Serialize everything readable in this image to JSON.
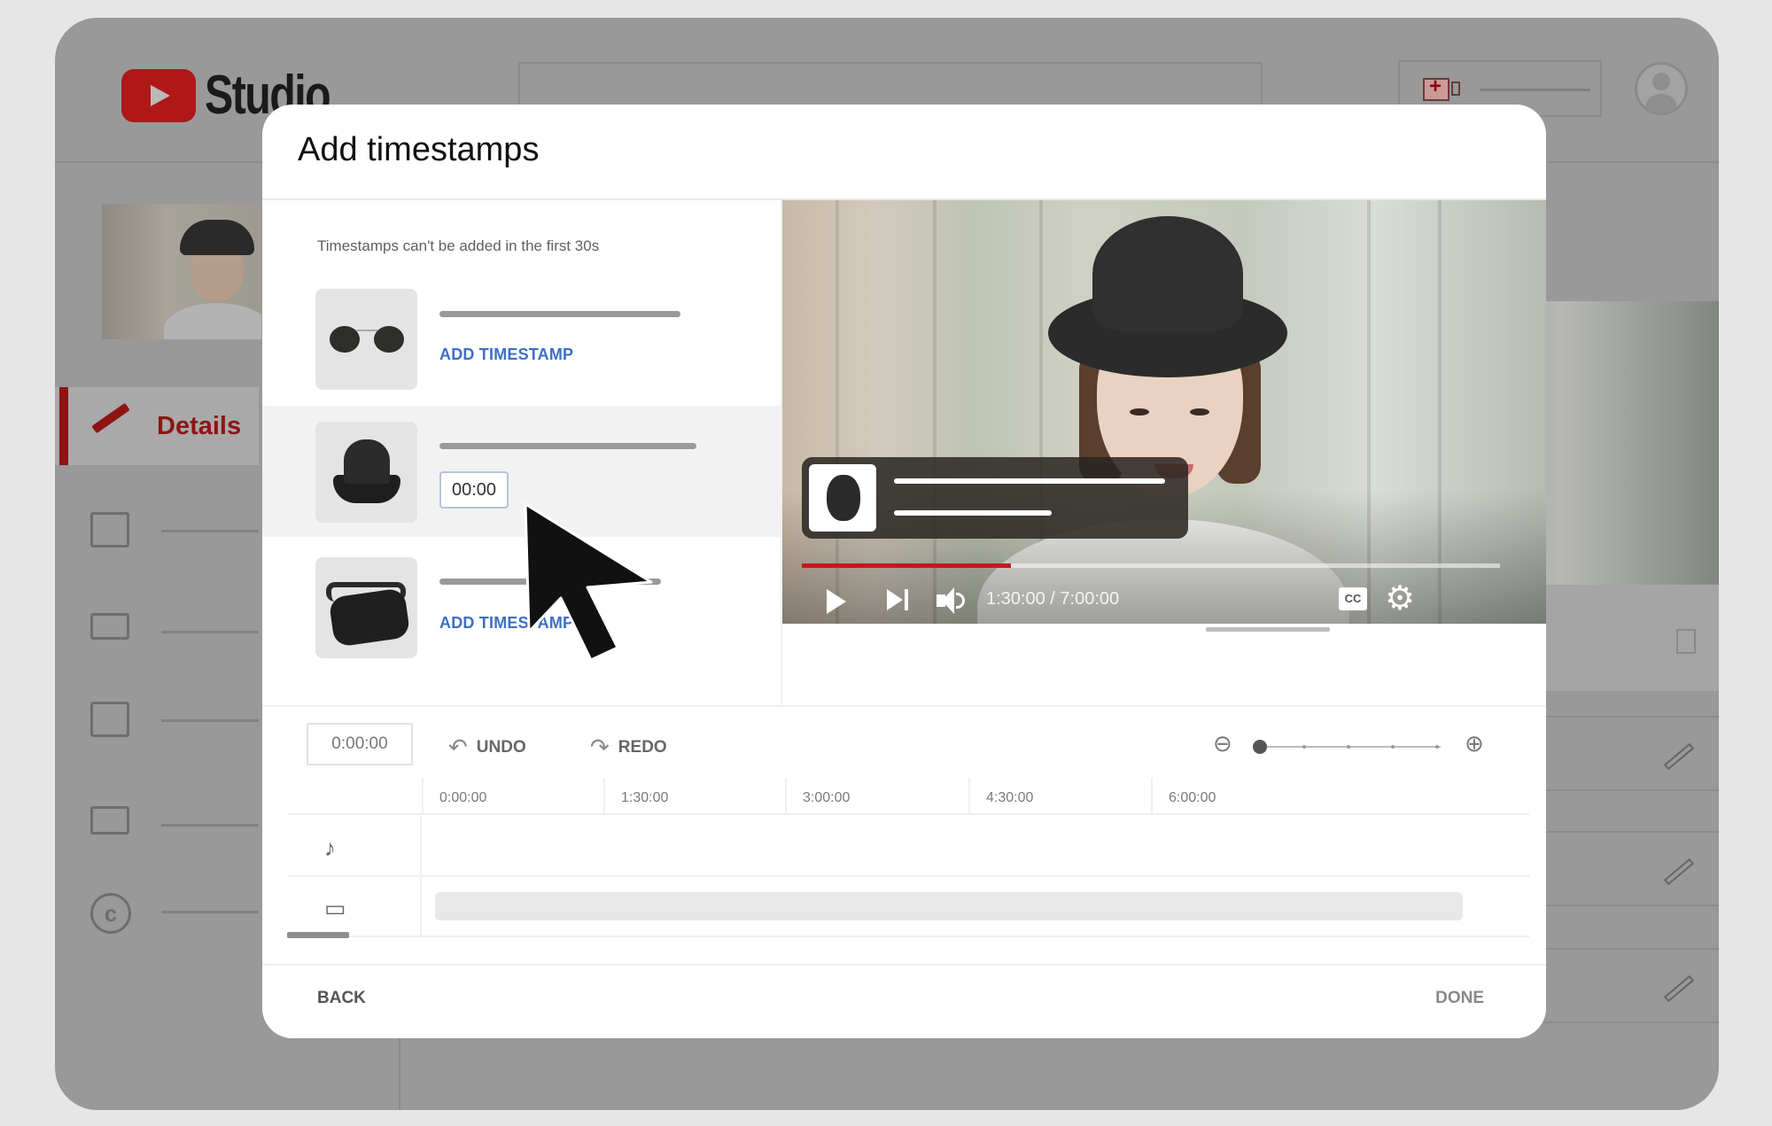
{
  "app": {
    "logo_text": "Studio",
    "sidebar": {
      "active_item": "Details",
      "items": [
        {
          "icon": "analytics-icon"
        },
        {
          "icon": "editor-icon"
        },
        {
          "icon": "comments-icon"
        },
        {
          "icon": "subtitles-icon"
        },
        {
          "icon": "copyright-icon"
        }
      ]
    }
  },
  "dialog": {
    "title": "Add timestamps",
    "note": "Timestamps can't be added in the first 30s",
    "products": [
      {
        "name": "sunglasses",
        "action_label": "ADD TIMESTAMP",
        "selected": false
      },
      {
        "name": "bucket-hat",
        "timestamp_value": "00:00",
        "selected": true
      },
      {
        "name": "belt-bag",
        "action_label": "ADD TIMESTAMP",
        "selected": false
      }
    ],
    "player": {
      "current_time": "1:30:00",
      "duration": "7:00:00",
      "time_readout": "1:30:00 / 7:00:00",
      "progress_fraction": 0.3,
      "cc_label": "CC",
      "accent_color": "#c4191f"
    },
    "toolbar": {
      "time_input_value": "0:00:00",
      "undo_label": "UNDO",
      "redo_label": "REDO",
      "zoom_level_index": 0,
      "zoom_levels": 5
    },
    "timeline": {
      "ruler_labels": [
        "0:00:00",
        "1:30:00",
        "3:00:00",
        "4:30:00",
        "6:00:00"
      ],
      "tracks": [
        {
          "icon": "music-note-icon"
        },
        {
          "icon": "video-track-icon"
        }
      ]
    },
    "footer": {
      "back_label": "BACK",
      "done_label": "DONE"
    }
  }
}
